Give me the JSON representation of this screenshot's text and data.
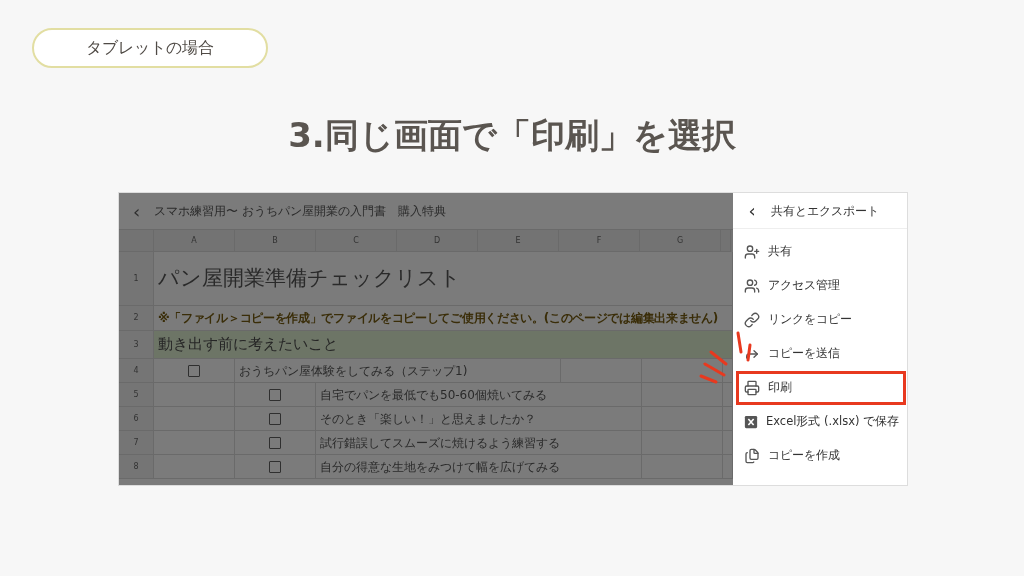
{
  "badge": "タブレットの場合",
  "heading": "3.同じ画面で「印刷」を選択",
  "sheet": {
    "back": "‹",
    "title": "スマホ練習用〜 おうちパン屋開業の入門書　購入特典",
    "columns": [
      "A",
      "B",
      "C",
      "D",
      "E",
      "F",
      "G"
    ],
    "rows": [
      {
        "number": "1",
        "kind": "title",
        "text": "パン屋開業準備チェックリスト"
      },
      {
        "number": "2",
        "kind": "note",
        "text": "※「ファイル＞コピーを作成」でファイルをコピーしてご使用ください。(このページでは編集出来ません)"
      },
      {
        "number": "3",
        "kind": "section",
        "text": "動き出す前に考えたいこと"
      },
      {
        "number": "4",
        "kind": "task",
        "checked": false,
        "text": "おうちパン屋体験をしてみる（ステップ1)"
      },
      {
        "number": "5",
        "kind": "subtask",
        "checked": false,
        "text": "自宅でパンを最低でも50-60個焼いてみる"
      },
      {
        "number": "6",
        "kind": "subtask",
        "checked": false,
        "text": "そのとき「楽しい！」と思えましたか？"
      },
      {
        "number": "7",
        "kind": "subtask",
        "checked": false,
        "text": "試行錯誤してスムーズに焼けるよう練習する"
      },
      {
        "number": "8",
        "kind": "subtask",
        "checked": false,
        "text": "自分の得意な生地をみつけて幅を広げてみる"
      }
    ]
  },
  "panel": {
    "back": "‹",
    "title": "共有とエクスポート",
    "items": [
      {
        "kind": "share",
        "label": "共有",
        "highlighted": false
      },
      {
        "kind": "access",
        "label": "アクセス管理",
        "highlighted": false
      },
      {
        "kind": "link",
        "label": "リンクをコピー",
        "highlighted": false
      },
      {
        "kind": "send",
        "label": "コピーを送信",
        "highlighted": false
      },
      {
        "kind": "print",
        "label": "印刷",
        "highlighted": true
      },
      {
        "kind": "excel",
        "label": "Excel形式 (.xlsx) で保存",
        "highlighted": false
      },
      {
        "kind": "copy",
        "label": "コピーを作成",
        "highlighted": false
      }
    ]
  }
}
